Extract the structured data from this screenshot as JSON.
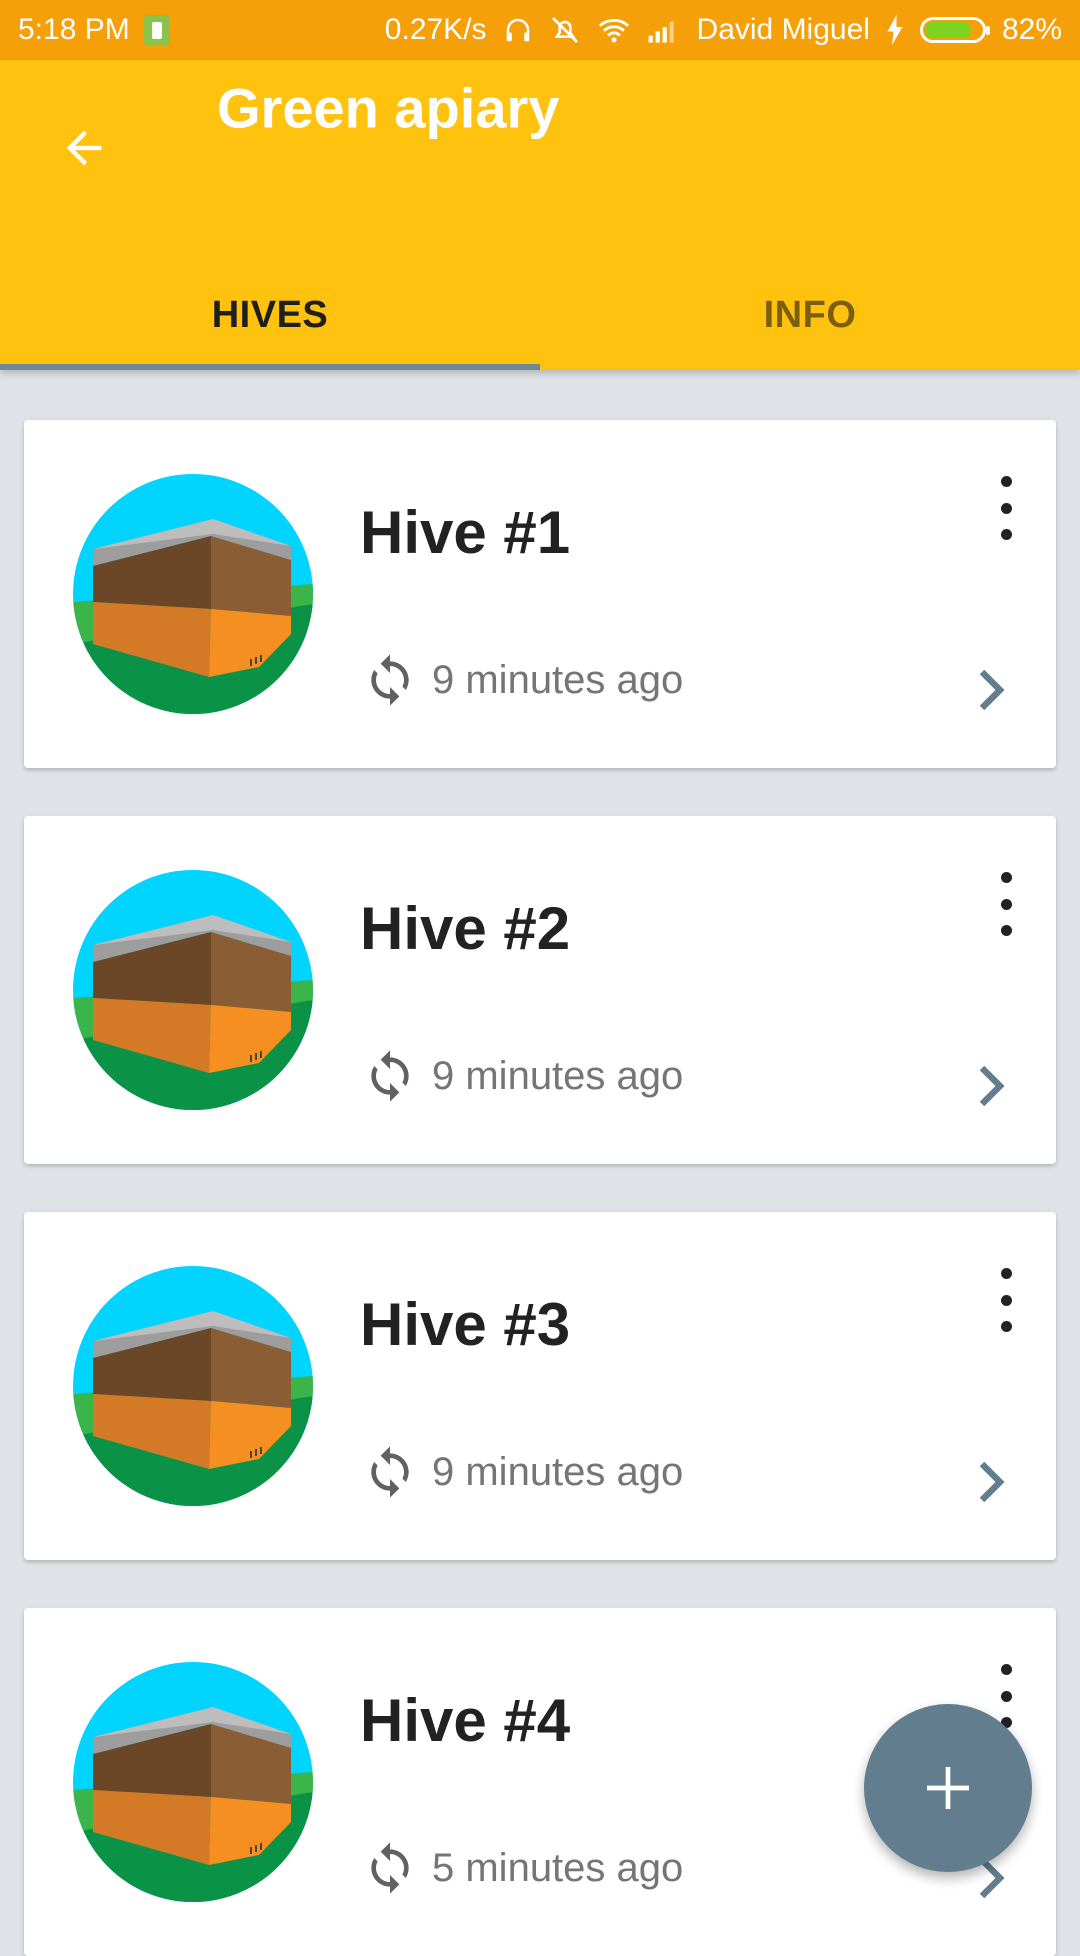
{
  "status_bar": {
    "time": "5:18 PM",
    "net_speed": "0.27K/s",
    "carrier": "David Miguel",
    "battery_pct": "82%",
    "battery_level": 0.82
  },
  "app_bar": {
    "title": "Green apiary",
    "back_icon": "arrow-back-icon"
  },
  "tabs": [
    {
      "label": "HIVES",
      "active": true
    },
    {
      "label": "INFO",
      "active": false
    }
  ],
  "hives": [
    {
      "name": "Hive #1",
      "last_sync": "9 minutes ago"
    },
    {
      "name": "Hive #2",
      "last_sync": "9 minutes ago"
    },
    {
      "name": "Hive #3",
      "last_sync": "9 minutes ago"
    },
    {
      "name": "Hive #4",
      "last_sync": "5 minutes ago"
    }
  ],
  "colors": {
    "status_bar": "#f59f09",
    "app_bar": "#ffc20e",
    "tab_indicator": "#6f8898",
    "fab": "#617d8e",
    "background": "#dfe3e7"
  }
}
